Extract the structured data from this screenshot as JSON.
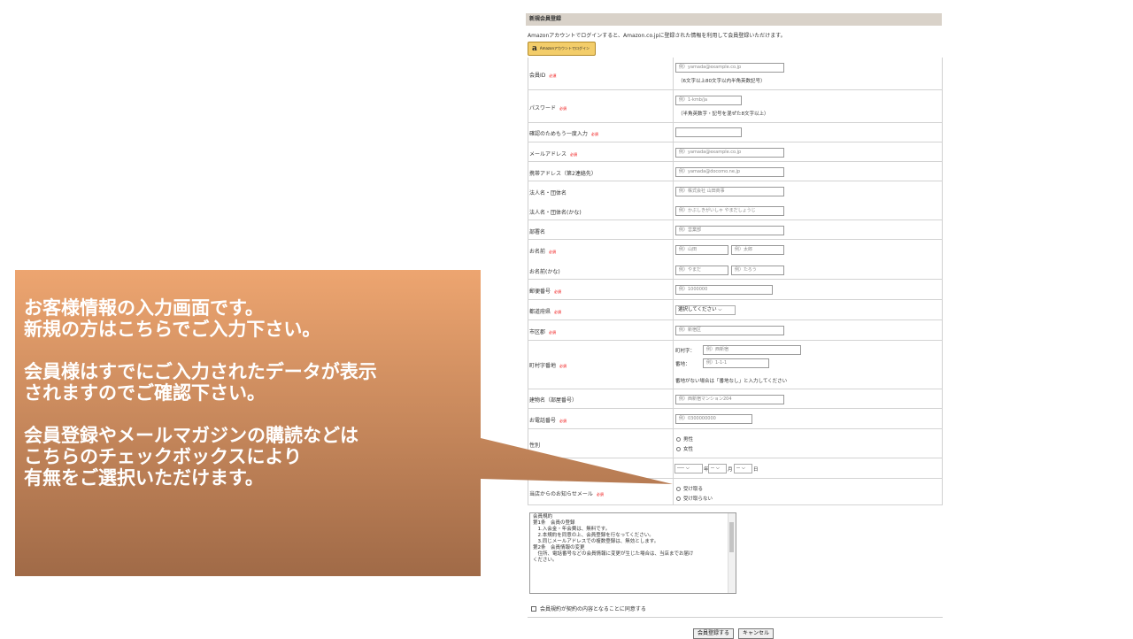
{
  "form": {
    "section_title": "新規会員登録",
    "amazon_intro": "Amazonアカウントでログインすると、Amazon.co.jpに登録された情報を利用して会員登録いただけます。",
    "amazon_button_logo": "a",
    "amazon_button_label": "Amazonアカウントでログイン",
    "required_mark": "必須",
    "fields": {
      "member_id": {
        "label": "会員ID",
        "placeholder": "例）yamada@example.co.jp",
        "hint": "（6文字以上80文字以内半角英数記号）"
      },
      "password": {
        "label": "パスワード",
        "placeholder": "例）1-kmb/ja",
        "hint": "（半角英数字・記号を混ぜた8文字以上）"
      },
      "password_confirm": {
        "label": "確認のためもう一度入力"
      },
      "email": {
        "label": "メールアドレス",
        "placeholder": "例）yamada@example.co.jp"
      },
      "mobile_email": {
        "label": "携帯アドレス（第2連絡先）",
        "placeholder": "例）yamada@docomo.ne.jp"
      },
      "company": {
        "label": "法人名・団体名",
        "placeholder": "例）株式会社 山田商事"
      },
      "company_kana": {
        "label": "法人名・団体名(かな)",
        "placeholder": "例）かぶしきがいしゃ やまだしょうじ"
      },
      "department": {
        "label": "部署名",
        "placeholder": "例）営業部"
      },
      "name": {
        "label": "お名前",
        "last_placeholder": "例）山田",
        "first_placeholder": "例）太郎"
      },
      "name_kana": {
        "label": "お名前(かな)",
        "last_placeholder": "例）やまだ",
        "first_placeholder": "例）たろう"
      },
      "postal": {
        "label": "郵便番号",
        "placeholder": "例）1000000"
      },
      "prefecture": {
        "label": "都道府県",
        "selected": "選択してください"
      },
      "city": {
        "label": "市区郡",
        "placeholder": "例）新宿区"
      },
      "town": {
        "label": "町村字番地",
        "town_label": "町村字：",
        "town_placeholder": "例）西新宿",
        "number_label": "番地：",
        "number_placeholder": "例）1-1-1",
        "note": "番地がない場合は「番地なし」と入力してください"
      },
      "building": {
        "label": "建物名（部屋番号）",
        "placeholder": "例）西新宿マンション204"
      },
      "phone": {
        "label": "お電話番号",
        "placeholder": "例）0300000000"
      },
      "gender": {
        "label": "性別",
        "options": [
          "男性",
          "女性"
        ]
      },
      "birthday": {
        "year_value": "----",
        "year_unit": "年",
        "month_value": "--",
        "month_unit": "月",
        "day_value": "--",
        "day_unit": "日"
      },
      "newsletter": {
        "label": "当店からのお知らせメール",
        "options": [
          "受け取る",
          "受け取らない"
        ]
      }
    },
    "terms": {
      "lines": [
        "会員規約",
        "",
        "第1条　会員の登録",
        "　1.入会金・年会費は、無料です。",
        "　2.本規約を同意の上、会員登録を行なってください。",
        "　3.同じメールアドレスでの複数登録は、無効とします。",
        "",
        "第2条　会員情報の変更",
        "　住所、電話番号などの会員情報に変更が生じた場合は、当店までお届け",
        "ください。"
      ]
    },
    "agree_label": "会員規約が契約の内容となることに同意する",
    "submit_label": "会員登録する",
    "cancel_label": "キャンセル"
  },
  "callout": {
    "lines": [
      "お客様情報の入力画面です。",
      "新規の方はこちらでご入力下さい。",
      "",
      "会員様はすでにご入力されたデータが表示",
      "されますのでご確認下さい。",
      "",
      "会員登録やメールマガジンの購読などは",
      "こちらのチェックボックスにより",
      "有無をご選択いただけます。"
    ],
    "gradient_top": "#eda570",
    "gradient_bottom": "#a06a47"
  }
}
